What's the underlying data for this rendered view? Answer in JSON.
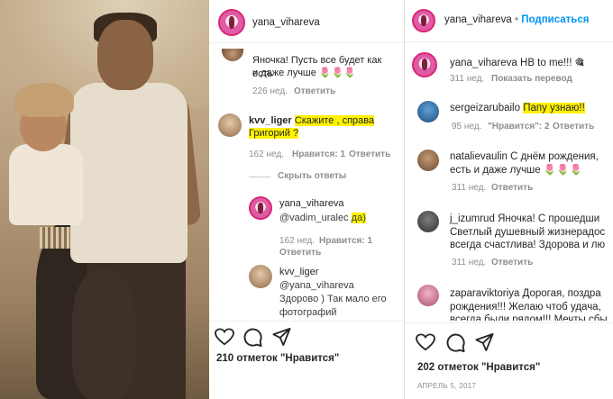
{
  "middle": {
    "header_username": "yana_vihareva",
    "comment1": {
      "text_line1": "Яночка! Пусть все будет как есть",
      "text_line2": "и даже лучше 🌷🌷🌷",
      "meta_time": "226 нед.",
      "meta_reply": "Ответить"
    },
    "comment2": {
      "username": "kvv_liger",
      "text_part1": "Скажите , справа",
      "text_part2": "Григорий ?",
      "meta_time": "162 нед.",
      "meta_likes": "Нравится: 1",
      "meta_reply": "Ответить"
    },
    "hide_replies": "Скрыть ответы",
    "reply1": {
      "username": "yana_vihareva",
      "mention": "@vadim_uralec",
      "text_highlight": "да)",
      "meta_time": "162 нед.",
      "meta_likes": "Нравится: 1",
      "meta_reply": "Ответить"
    },
    "reply2": {
      "username": "kvv_liger",
      "line1": "@yana_vihareva",
      "line2": "Здорово ) Так мало его",
      "line3": "фотографий"
    },
    "likes": "210 отметок \"Нравится\""
  },
  "right": {
    "header_username": "yana_vihareva",
    "header_follow": "Подписаться",
    "caption": {
      "username": "yana_vihareva",
      "text": "НВ to me!!! 🎕",
      "meta_time": "311 нед.",
      "meta_translate": "Показать перевод"
    },
    "comments": [
      {
        "username": "sergeizarubailo",
        "text": "Папу узнаю!!",
        "meta_time": "95 нед.",
        "meta_likes": "\"Нравится\": 2",
        "meta_reply": "Ответить"
      },
      {
        "username": "natalievaulin",
        "text_line1": "С днём рождения,",
        "text_line2": "есть и даже лучше 🌷🌷🌷",
        "meta_time": "311 нед.",
        "meta_reply": "Ответить"
      },
      {
        "username": "j_izumrud",
        "text_line1": "Яночка! С прошедши",
        "text_line2": "Светлый душевный жизнерадос",
        "text_line3": "всегда счастлива! Здорова и лю",
        "meta_time": "311 нед.",
        "meta_reply": "Ответить"
      },
      {
        "username": "zaparaviktoriya",
        "text_line1": "Дорогая, поздра",
        "text_line2": "рождения!!! Желаю чтоб удача,",
        "text_line3": "всегда были рядом!!! Мечты сбы"
      }
    ],
    "likes": "202 отметок \"Нравится\"",
    "date": "АПРЕЛЬ 5, 2017"
  }
}
